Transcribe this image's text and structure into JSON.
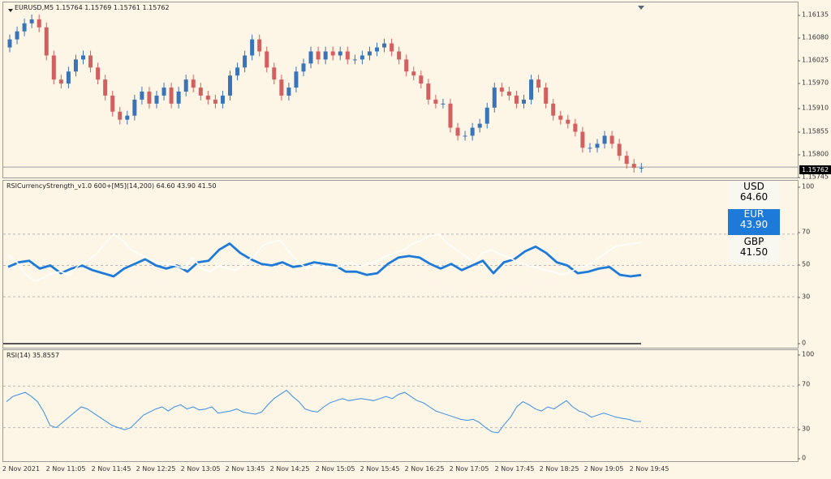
{
  "main": {
    "header": "EURUSD,M5  1.15764 1.15769 1.15761 1.15762",
    "price_axis": [
      "1.16135",
      "1.16080",
      "1.16025",
      "1.15970",
      "1.15910",
      "1.15855",
      "1.15800",
      "1.15745"
    ],
    "current_price": "1.15762",
    "up_color": "#3a74b8",
    "down_color": "#d26060"
  },
  "rsi_cs": {
    "header": "RSICurrencyStrength_v1.0 600+[M5](14,200) 64.60 43.90 41.50",
    "axis": [
      "100",
      "70",
      "50",
      "30",
      "0"
    ],
    "boxes": {
      "usd": {
        "label": "USD",
        "value": "64.60"
      },
      "eur": {
        "label": "EUR",
        "value": "43.90"
      },
      "gbp": {
        "label": "GBP",
        "value": "41.50"
      }
    },
    "colors": {
      "usd": "#ffffff",
      "eur": "#1e7ad8",
      "gbp": "#fff5ea"
    }
  },
  "rsi": {
    "header": "RSI(14) 35.8557",
    "axis": [
      "100",
      "70",
      "30",
      "0"
    ],
    "color": "#3a8ee6"
  },
  "time_axis": [
    "2 Nov 2021",
    "2 Nov 11:05",
    "2 Nov 11:45",
    "2 Nov 12:25",
    "2 Nov 13:05",
    "2 Nov 13:45",
    "2 Nov 14:25",
    "2 Nov 15:05",
    "2 Nov 15:45",
    "2 Nov 16:25",
    "2 Nov 17:05",
    "2 Nov 17:45",
    "2 Nov 18:25",
    "2 Nov 19:05",
    "2 Nov 19:45"
  ],
  "chart_data": [
    {
      "type": "candlestick",
      "title": "EURUSD,M5",
      "ylim": [
        1.1574,
        1.1616
      ],
      "close": [
        1.1608,
        1.161,
        1.1612,
        1.1613,
        1.1611,
        1.1604,
        1.1598,
        1.1597,
        1.16,
        1.1603,
        1.1604,
        1.1601,
        1.1598,
        1.1594,
        1.159,
        1.1588,
        1.1589,
        1.1593,
        1.1595,
        1.1592,
        1.1594,
        1.1596,
        1.1592,
        1.1595,
        1.1598,
        1.1596,
        1.1594,
        1.1593,
        1.1592,
        1.1594,
        1.1599,
        1.1601,
        1.1604,
        1.1608,
        1.1605,
        1.1601,
        1.1598,
        1.1594,
        1.1596,
        1.16,
        1.1602,
        1.1605,
        1.1603,
        1.1605,
        1.1604,
        1.1605,
        1.1603,
        1.1603,
        1.1604,
        1.1605,
        1.1606,
        1.1607,
        1.1605,
        1.1603,
        1.16,
        1.1599,
        1.1597,
        1.1593,
        1.1592,
        1.1592,
        1.1586,
        1.1584,
        1.1584,
        1.1586,
        1.1587,
        1.1591,
        1.1596,
        1.1595,
        1.1594,
        1.1592,
        1.1593,
        1.1598,
        1.1596,
        1.1592,
        1.1589,
        1.1588,
        1.1587,
        1.1585,
        1.1581,
        1.1581,
        1.1582,
        1.1584,
        1.1582,
        1.1579,
        1.1577,
        1.1576,
        1.1576
      ]
    },
    {
      "type": "line",
      "title": "RSICurrencyStrength_v1.0 600+[M5](14,200)",
      "ylim": [
        0,
        100
      ],
      "series": [
        {
          "name": "USD",
          "values": [
            57,
            52,
            44,
            40,
            42,
            45,
            46,
            44,
            50,
            53,
            57,
            64,
            70,
            66,
            60,
            57,
            54,
            52,
            51,
            50,
            48,
            55,
            48,
            46,
            50,
            48,
            47,
            52,
            56,
            63,
            65,
            66,
            58,
            52,
            48,
            50,
            49,
            48,
            50,
            52,
            49,
            51,
            53,
            56,
            58,
            60,
            64,
            66,
            69,
            70,
            64,
            60,
            56,
            52,
            58,
            60,
            57,
            55,
            52,
            50,
            49,
            47,
            46,
            44,
            46,
            49,
            50,
            54,
            58,
            62,
            63,
            64,
            64.6
          ]
        },
        {
          "name": "EUR",
          "values": [
            49,
            52,
            53,
            48,
            50,
            45,
            48,
            50,
            47,
            45,
            43,
            48,
            51,
            54,
            50,
            48,
            50,
            46,
            52,
            53,
            60,
            64,
            58,
            54,
            51,
            50,
            52,
            49,
            50,
            52,
            51,
            50,
            46,
            46,
            44,
            45,
            51,
            55,
            56,
            55,
            51,
            48,
            51,
            47,
            50,
            53,
            45,
            52,
            54,
            59,
            62,
            58,
            52,
            50,
            45,
            46,
            48,
            49,
            44,
            43,
            43.9
          ]
        },
        {
          "name": "GBP",
          "values": [
            47,
            47,
            49,
            51,
            48,
            47,
            46,
            45,
            41,
            40,
            42,
            40,
            38,
            40,
            44,
            43,
            41,
            44,
            40,
            42,
            41,
            40,
            44,
            46,
            47,
            45,
            42,
            40,
            42,
            41,
            44,
            45,
            44,
            46,
            43,
            44,
            39,
            38,
            36,
            35,
            34,
            33,
            32,
            34,
            36,
            37,
            40,
            38,
            39,
            40,
            42,
            43,
            41,
            40,
            41.5
          ]
        }
      ],
      "levels": [
        70,
        50,
        30
      ]
    },
    {
      "type": "line",
      "title": "RSI(14)",
      "ylim": [
        0,
        100
      ],
      "series": [
        {
          "name": "RSI(14)",
          "values": [
            55,
            60,
            62,
            64,
            60,
            55,
            45,
            32,
            30,
            35,
            40,
            45,
            50,
            48,
            44,
            40,
            36,
            32,
            30,
            28,
            30,
            36,
            42,
            45,
            48,
            50,
            46,
            50,
            52,
            48,
            50,
            47,
            48,
            50,
            44,
            45,
            46,
            48,
            45,
            44,
            43,
            45,
            52,
            58,
            62,
            66,
            60,
            55,
            48,
            46,
            45,
            50,
            54,
            56,
            58,
            56,
            57,
            58,
            57,
            56,
            58,
            60,
            58,
            62,
            64,
            60,
            56,
            54,
            50,
            46,
            44,
            42,
            40,
            38,
            37,
            38,
            35,
            30,
            26,
            25,
            33,
            40,
            50,
            55,
            52,
            48,
            46,
            50,
            48,
            52,
            56,
            50,
            46,
            44,
            40,
            42,
            44,
            42,
            40,
            39,
            38,
            36,
            35.9
          ]
        }
      ],
      "levels": [
        70,
        30
      ]
    }
  ]
}
